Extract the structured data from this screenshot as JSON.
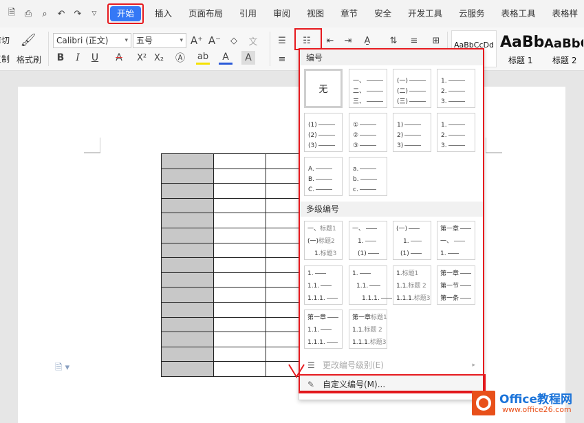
{
  "menubar": {
    "tabs": [
      "开始",
      "插入",
      "页面布局",
      "引用",
      "审阅",
      "视图",
      "章节",
      "安全",
      "开发工具",
      "云服务",
      "表格工具",
      "表格样"
    ]
  },
  "ribbon": {
    "cut_label": "剪切",
    "copy_label": "复制",
    "format_painter_label": "格式刷",
    "font_name": "Calibri (正文)",
    "font_size": "五号",
    "style_normal": "AaBbCcDd",
    "style_h1_preview": "AaBb",
    "style_h1_label": "标题 1",
    "style_h2_preview": "AaBbC",
    "style_h2_label": "标题 2"
  },
  "dropdown": {
    "numbering_header": "编号",
    "none_label": "无",
    "multilevel_header": "多级编号",
    "change_level_label": "更改编号级别(E)",
    "custom_numbering_label": "自定义编号(M)...",
    "single": [
      [
        "一、",
        "二、",
        "三、"
      ],
      [
        "(一)",
        "(二)",
        "(三)"
      ],
      [
        "1.",
        "2.",
        "3."
      ],
      [
        "(1)",
        "(2)",
        "(3)"
      ],
      [
        "①",
        "②",
        "③"
      ],
      [
        "1)",
        "2)",
        "3)"
      ],
      [
        "1.",
        "2.",
        "3."
      ],
      [
        "A.",
        "B.",
        "C."
      ],
      [
        "a.",
        "b.",
        "c."
      ]
    ],
    "multi": [
      [
        {
          "p": "一、",
          "t": "标题1"
        },
        {
          "p": "(一)",
          "t": "标题2"
        },
        {
          "p": "1.",
          "t": "标题3"
        }
      ],
      [
        {
          "p": "一、",
          "t": ""
        },
        {
          "p": "1.",
          "t": ""
        },
        {
          "p": "(1)",
          "t": ""
        }
      ],
      [
        {
          "p": "(一)",
          "t": ""
        },
        {
          "p": "1.",
          "t": ""
        },
        {
          "p": "(1)",
          "t": ""
        }
      ],
      [
        {
          "p": "第一章",
          "t": ""
        },
        {
          "p": "一、",
          "t": ""
        },
        {
          "p": "1.",
          "t": ""
        }
      ],
      [
        {
          "p": "1.",
          "t": ""
        },
        {
          "p": "1.1.",
          "t": ""
        },
        {
          "p": "1.1.1.",
          "t": ""
        }
      ],
      [
        {
          "p": "1.",
          "t": ""
        },
        {
          "p": "1.1.",
          "t": ""
        },
        {
          "p": "1.1.1.",
          "t": ""
        }
      ],
      [
        {
          "p": "1.",
          "t": "标题1"
        },
        {
          "p": "1.1.",
          "t": "标题 2"
        },
        {
          "p": "1.1.1.",
          "t": "标题3"
        }
      ],
      [
        {
          "p": "第一章",
          "t": ""
        },
        {
          "p": "第一节",
          "t": ""
        },
        {
          "p": "第一条",
          "t": ""
        }
      ],
      [
        {
          "p": "第一章",
          "t": ""
        },
        {
          "p": "1.1.",
          "t": ""
        },
        {
          "p": "1.1.1.",
          "t": ""
        }
      ],
      [
        {
          "p": "第一章",
          "t": "标题1"
        },
        {
          "p": "1.1.",
          "t": "标题 2"
        },
        {
          "p": "1.1.1.",
          "t": "标题3"
        }
      ]
    ]
  },
  "logo": {
    "title": "Office教程网",
    "url": "www.office26.com"
  }
}
